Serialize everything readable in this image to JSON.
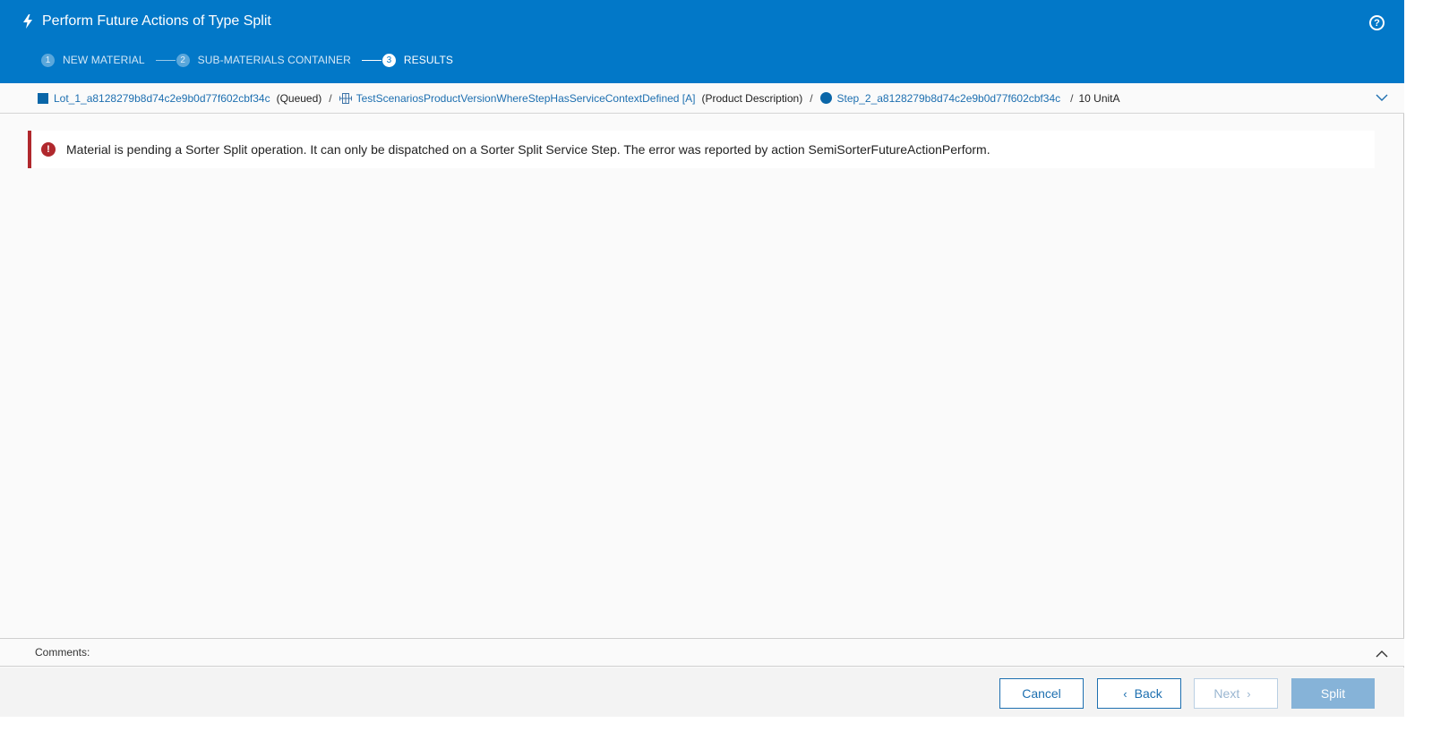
{
  "header": {
    "title": "Perform Future Actions of Type Split",
    "icon": "bolt-icon",
    "help_icon": "help-icon",
    "steps": [
      {
        "number": "1",
        "label": "NEW MATERIAL",
        "active": false
      },
      {
        "number": "2",
        "label": "SUB-MATERIALS CONTAINER",
        "active": false
      },
      {
        "number": "3",
        "label": "RESULTS",
        "active": true
      }
    ]
  },
  "breadcrumb": {
    "lot_name": "Lot_1_a8128279b8d74c2e9b0d77f602cbf34c",
    "lot_state": "(Queued)",
    "separator": "/",
    "product_name": "TestScenariosProductVersionWhereStepHasServiceContextDefined [A]",
    "product_description": "(Product Description)",
    "step_name": "Step_2_a8128279b8d74c2e9b0d77f602cbf34c",
    "quantity": "10 UnitA"
  },
  "error": {
    "message": "Material is pending a Sorter Split operation. It can only be dispatched on a Sorter Split Service Step. The error was reported by action SemiSorterFutureActionPerform.",
    "color": "#b0282d"
  },
  "comments": {
    "label": "Comments:"
  },
  "footer": {
    "cancel_label": "Cancel",
    "back_label": "Back",
    "next_label": "Next",
    "split_label": "Split"
  },
  "colors": {
    "header_bg": "#0278c8",
    "link": "#1d6fb0",
    "primary_disabled": "#86b3d8"
  }
}
